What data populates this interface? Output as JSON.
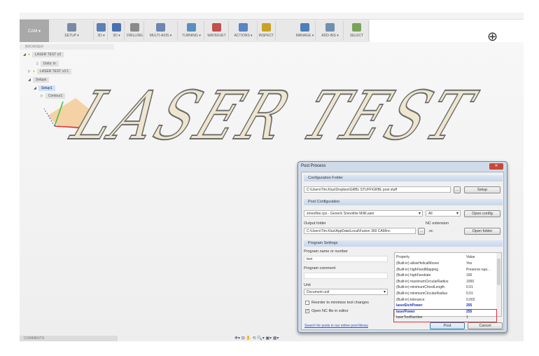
{
  "toolbar": {
    "workspace": "CAM ▾",
    "groups": [
      "SETUP ▾",
      "2D ▾",
      "3D ▾",
      "DRILLING",
      "MULTI-AXIS ▾",
      "TURNING ▾",
      "WATERJET",
      "ACTIONS ▾",
      "INSPECT",
      "MANAGE ▾",
      "ADD-INS ▾",
      "SELECT"
    ]
  },
  "browser": {
    "header": "BROWSER",
    "items": [
      "LASER TEST v3",
      "Units: in",
      "LASER TEST v3:1",
      "Setups",
      "Setup1",
      "Contour1"
    ]
  },
  "model_text": "LASER TEST",
  "comments": "COMMENTS",
  "dialog": {
    "title": "Post Process",
    "close": "✕",
    "config_folder": {
      "header": "Configuration Folder",
      "path": "C:\\Users\\Tim.Klus\\Dropbox\\GRBL STUFF\\GRBL post stuff",
      "browse": "...",
      "setup": "Setup"
    },
    "post_config": {
      "header": "Post Configuration",
      "post": "smoothie.cps - Generic Smoothie Mill/Laser",
      "filter": "All",
      "open_config": "Open config",
      "output_label": "Output folder",
      "output_path": "C:\\Users\\Tim.Klus\\AppData\\Local\\Fusion 360 CAM\\nc",
      "browse": "...",
      "ext_label": "NC extension",
      "ext": ".nc",
      "open_folder": "Open folder"
    },
    "program": {
      "header": "Program Settings",
      "name_label": "Program name or number",
      "name": "test",
      "comment_label": "Program comment",
      "comment": "",
      "unit_label": "Unit",
      "unit": "Document unit",
      "reorder": "Reorder to minimize tool changes",
      "reorder_checked": false,
      "open_nc": "Open NC file in editor",
      "open_nc_checked": true
    },
    "properties": {
      "headers": [
        "Property",
        "Value"
      ],
      "rows": [
        [
          "(Built-in) allowHelicalMoves",
          "Yes"
        ],
        [
          "(Built-in) highFeedMapping",
          "Preserve rapi..."
        ],
        [
          "(Built-in) highFeedrate",
          "100"
        ],
        [
          "(Built-in) maximumCircularRadius",
          "1000"
        ],
        [
          "(Built-in) minimumChordLength",
          "0.01"
        ],
        [
          "(Built-in) minimumCircularRadius",
          "0.01"
        ],
        [
          "(Built-in) tolerance",
          "0.002"
        ],
        [
          "laserEtchPower",
          "255"
        ],
        [
          "laserPower",
          "255"
        ],
        [
          "laserToolNumber",
          "1"
        ]
      ]
    },
    "link": "Search for posts in our online post library",
    "post": "Post",
    "cancel": "Cancel"
  }
}
